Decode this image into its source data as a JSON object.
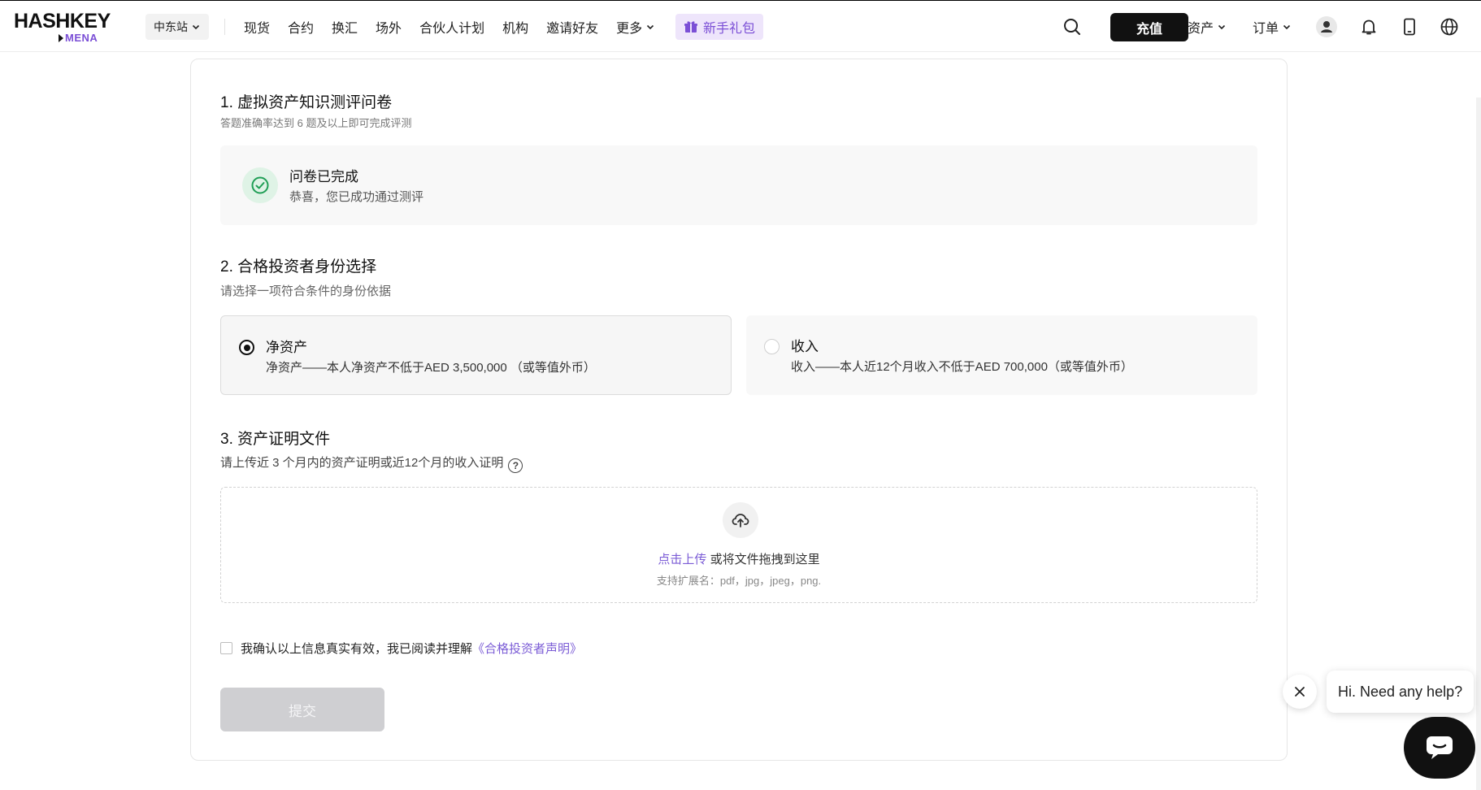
{
  "header": {
    "logo_main": "HASHKEY",
    "logo_sub": "MENA",
    "region": "中东站",
    "nav": [
      {
        "label": "现货",
        "dropdown": false
      },
      {
        "label": "合约",
        "dropdown": false
      },
      {
        "label": "换汇",
        "dropdown": false
      },
      {
        "label": "场外",
        "dropdown": false
      },
      {
        "label": "合伙人计划",
        "dropdown": false
      },
      {
        "label": "机构",
        "dropdown": false
      },
      {
        "label": "邀请好友",
        "dropdown": false
      },
      {
        "label": "更多",
        "dropdown": true
      }
    ],
    "gift": "新手礼包",
    "deposit": "充值",
    "assets": "资产",
    "orders": "订单",
    "icons": [
      "search-icon",
      "user-icon",
      "bell-icon",
      "mobile-icon",
      "globe-icon"
    ]
  },
  "section1": {
    "title": "1. 虚拟资产知识测评问卷",
    "subtitle": "答题准确率达到 6 题及以上即可完成评测",
    "done_title": "问卷已完成",
    "done_sub": "恭喜，您已成功通过测评"
  },
  "section2": {
    "title": "2. 合格投资者身份选择",
    "subtitle": "请选择一项符合条件的身份依据",
    "options": [
      {
        "title": "净资产",
        "desc": "净资产——本人净资产不低于AED 3,500,000 （或等值外币）",
        "selected": true
      },
      {
        "title": "收入",
        "desc": "收入——本人近12个月收入不低于AED 700,000（或等值外币）",
        "selected": false
      }
    ]
  },
  "section3": {
    "title": "3. 资产证明文件",
    "subtitle": "请上传近 3 个月内的资产证明或近12个月的收入证明",
    "upload_link": "点击上传",
    "upload_text": " 或将文件拖拽到这里",
    "upload_hint": "支持扩展名：pdf，jpg，jpeg，png."
  },
  "agree": {
    "text": "我确认以上信息真实有效，我已阅读并理解",
    "link": "《合格投资者声明》"
  },
  "submit": "提交",
  "chat": {
    "bubble": "Hi. Need any help?"
  },
  "colors": {
    "accent": "#7b4fd6",
    "link": "#7b5cd6",
    "success": "#1f9e55",
    "primary_button": "#111111",
    "disabled_button": "#cfcfd2"
  }
}
